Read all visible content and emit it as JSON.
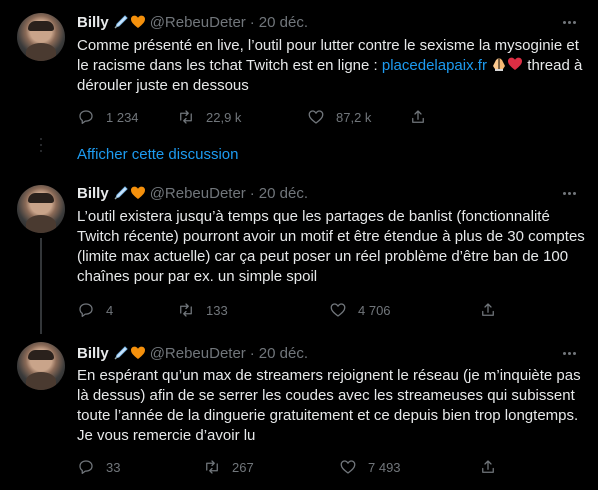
{
  "colors": {
    "background": "#000000",
    "text": "#e7e9ea",
    "muted": "#71767b",
    "link": "#1d9bf0",
    "like": "#71767b"
  },
  "show_thread_label": "Afficher cette discussion",
  "tweets": [
    {
      "author": "Billy",
      "badges": [
        "syringe-icon",
        "orange-heart-icon"
      ],
      "handle": "@RebeuDeter",
      "separator": "·",
      "date": "20 déc.",
      "text_before_link": "Comme présenté en live, l’outil pour lutter contre le sexisme la mysoginie et le racisme dans les tchat Twitch est en ligne : ",
      "link": "placedelapaix.fr",
      "text_after_link": " thread à dérouler juste en dessous",
      "inline_emojis": [
        "praying-hands-icon",
        "red-heart-icon"
      ],
      "replies": "1 234",
      "retweets": "22,9 k",
      "likes": "87,2 k"
    },
    {
      "author": "Billy",
      "badges": [
        "syringe-icon",
        "orange-heart-icon"
      ],
      "handle": "@RebeuDeter",
      "separator": "·",
      "date": "20 déc.",
      "text": "L’outil existera jusqu’à temps que les partages de banlist (fonctionnalité Twitch récente) pourront avoir un motif et être étendue à plus de 30 comptes (limite max actuelle) car ça peut poser un réel problème d’être ban de 100 chaînes pour par ex. un simple spoil",
      "replies": "4",
      "retweets": "133",
      "likes": "4 706"
    },
    {
      "author": "Billy",
      "badges": [
        "syringe-icon",
        "orange-heart-icon"
      ],
      "handle": "@RebeuDeter",
      "separator": "·",
      "date": "20 déc.",
      "text": "En espérant qu’un max de streamers rejoignent le réseau (je m’inquiète pas là dessus) afin de se serrer les coudes avec les streameuses qui subissent toute l’année de la dinguerie gratuitement et ce depuis bien trop longtemps. Je vous remercie d’avoir lu",
      "replies": "33",
      "retweets": "267",
      "likes": "7 493"
    }
  ]
}
